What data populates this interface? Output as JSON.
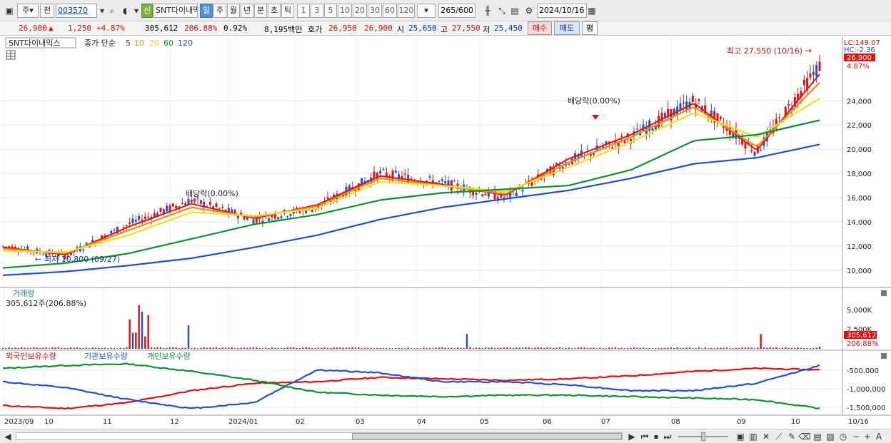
{
  "toolbar": {
    "type_label": "주",
    "jeon_label": "전",
    "code": "003570",
    "sin_badge": "신",
    "stock_name": "SNT다이내믹",
    "periods": [
      "일",
      "주",
      "월",
      "년",
      "분",
      "초",
      "틱"
    ],
    "nums": [
      "1",
      "3",
      "5",
      "10",
      "20",
      "30",
      "60",
      "120"
    ],
    "count": "265",
    "total": "/600",
    "date": "2024/10/16"
  },
  "quote": {
    "price": "26,900",
    "change": "1,250",
    "arrow": "▲",
    "pct": "+4.87%",
    "volume": "305,612",
    "vol_ratio": "206.88%",
    "turnover": "0.92%",
    "amount": "8,195백만",
    "hoga_label": "호가",
    "ask": "26,950",
    "bid": "26,900",
    "open_label": "시",
    "open": "25,650",
    "high_label": "고",
    "high": "27,550",
    "low_label": "저",
    "low": "25,450",
    "buy": "매수",
    "sell": "매도",
    "eval": "평"
  },
  "price_panel": {
    "name_label": "SNT다이내믹스",
    "ma_label": "종가 단순",
    "ma_periods": [
      "5",
      "10",
      "20",
      "60",
      "120"
    ],
    "ma_colors": [
      "#e01010",
      "#f08a10",
      "#f0e020",
      "#109030",
      "#2050d0"
    ],
    "lc_label": "LC:149.07",
    "hc_label": "HC:-2.36",
    "last_price": "26,900",
    "last_pct": "4.87%",
    "high_note": "최고 27,550 (10/16)",
    "low_note": "최저 10,800 (09/27)",
    "div_notes": [
      "배당락(0.00%)",
      "배당락(0.00%)"
    ],
    "y_ticks": [
      "24,000",
      "22,000",
      "20,000",
      "18,000",
      "16,000",
      "14,000",
      "12,000",
      "10,000"
    ],
    "y_values": [
      24000,
      22000,
      20000,
      18000,
      16000,
      14000,
      12000,
      10000
    ]
  },
  "volume_panel": {
    "title": "거래량",
    "value_note": "305,612주(206.88%)",
    "y_ticks": [
      "5,000K",
      "2,500K"
    ],
    "last_value": "305,612",
    "last_pct": "206.88%"
  },
  "holder_panel": {
    "legend": [
      {
        "label": "외국인보유수량",
        "color": "#e01010"
      },
      {
        "label": "기관보유수량",
        "color": "#2050d0"
      },
      {
        "label": "개인보유수량",
        "color": "#109030"
      }
    ],
    "y_ticks": [
      "-500,000",
      "-1,000,000",
      "-1,500,000"
    ]
  },
  "x_axis": {
    "labels": [
      "2023/09",
      "10",
      "11",
      "12",
      "2024/01",
      "02",
      "03",
      "04",
      "05",
      "06",
      "07",
      "08",
      "09",
      "10"
    ],
    "right_label": "10/16"
  },
  "chart_data": [
    {
      "type": "line",
      "series": [
        {
          "name": "SNT다이내믹스",
          "x": [
            "2023/09",
            "2023/10",
            "2023/11",
            "2023/12",
            "2024/01",
            "2024/02",
            "2024/03",
            "2024/04",
            "2024/05",
            "2024/06",
            "2024/07",
            "2024/08",
            "2024/09",
            "2024/10/16"
          ],
          "values": [
            12000,
            11200,
            13800,
            15800,
            14200,
            15200,
            18000,
            17200,
            16000,
            19000,
            21000,
            24000,
            19800,
            26900
          ]
        },
        {
          "name": "5",
          "values": [
            11900,
            11300,
            13600,
            15500,
            14300,
            15400,
            17800,
            17100,
            16200,
            19200,
            21200,
            23800,
            19900,
            26200
          ]
        },
        {
          "name": "10",
          "values": [
            11800,
            11400,
            13300,
            15200,
            14400,
            15300,
            17600,
            17000,
            16300,
            18900,
            21000,
            23500,
            20200,
            25500
          ]
        },
        {
          "name": "20",
          "values": [
            11600,
            11500,
            12900,
            14800,
            14500,
            15100,
            17300,
            17000,
            16500,
            18500,
            20600,
            23000,
            21000,
            24200
          ]
        },
        {
          "name": "60",
          "values": [
            10200,
            10600,
            11400,
            12600,
            13800,
            14600,
            15800,
            16400,
            16700,
            17000,
            18300,
            20700,
            21200,
            22400
          ]
        },
        {
          "name": "120",
          "values": [
            9600,
            9900,
            10400,
            11000,
            11900,
            12900,
            14200,
            15200,
            15900,
            16600,
            17600,
            18800,
            19300,
            20400
          ]
        }
      ],
      "ylim": [
        9000,
        27550
      ]
    },
    {
      "type": "bar",
      "title": "거래량",
      "last_value": 305612,
      "peak": 6500000,
      "ylim": [
        0,
        7000000
      ]
    },
    {
      "type": "line",
      "series": [
        {
          "name": "외국인보유수량",
          "values": [
            -1500000,
            -1600000,
            -1400000,
            -1000000,
            -750000,
            -700000,
            -550000,
            -600000,
            -650000,
            -600000,
            -500000,
            -350000,
            -250000,
            -300000
          ]
        },
        {
          "name": "기관보유수량",
          "values": [
            -700000,
            -900000,
            -1300000,
            -1600000,
            -1400000,
            -300000,
            -400000,
            -700000,
            -700000,
            -800000,
            -1000000,
            -1000000,
            -750000,
            -150000
          ]
        },
        {
          "name": "개인보유수량",
          "values": [
            -250000,
            -150000,
            -100000,
            -350000,
            -650000,
            -1050000,
            -1150000,
            -1200000,
            -1150000,
            -1150000,
            -1200000,
            -1250000,
            -1300000,
            -1600000
          ]
        }
      ],
      "ylim": [
        -1800000,
        0
      ]
    }
  ],
  "status": {
    "buttons": [
      "◀",
      "▶",
      "⏮",
      "⏹",
      "⏭"
    ]
  }
}
